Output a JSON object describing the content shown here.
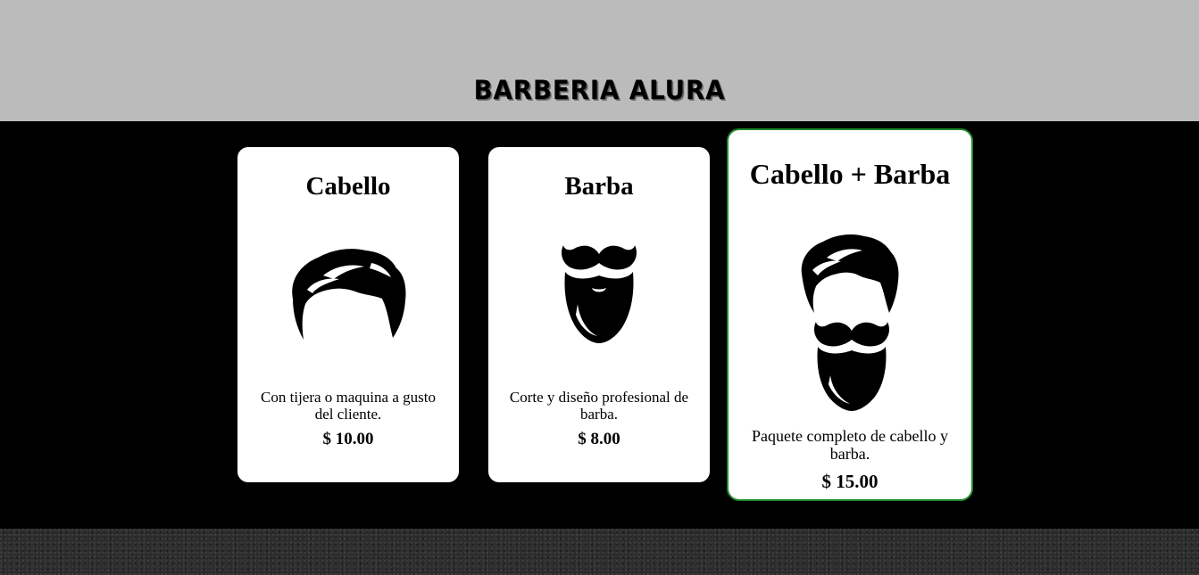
{
  "header": {
    "brand": "BARBERIA ALURA"
  },
  "services": [
    {
      "title": "Cabello",
      "description": "Con tijera o maquina a gusto del cliente.",
      "price": "$ 10.00",
      "icon": "hair-icon"
    },
    {
      "title": "Barba",
      "description": "Corte y diseño profesional de barba.",
      "price": "$ 8.00",
      "icon": "beard-icon"
    },
    {
      "title": "Cabello + Barba",
      "description": "Paquete completo de cabello y barba.",
      "price": "$ 15.00",
      "icon": "hair-and-beard-icon"
    }
  ],
  "colors": {
    "header_bg": "#bbbbbb",
    "main_bg": "#000000",
    "highlight_border": "#1f8a2a"
  }
}
